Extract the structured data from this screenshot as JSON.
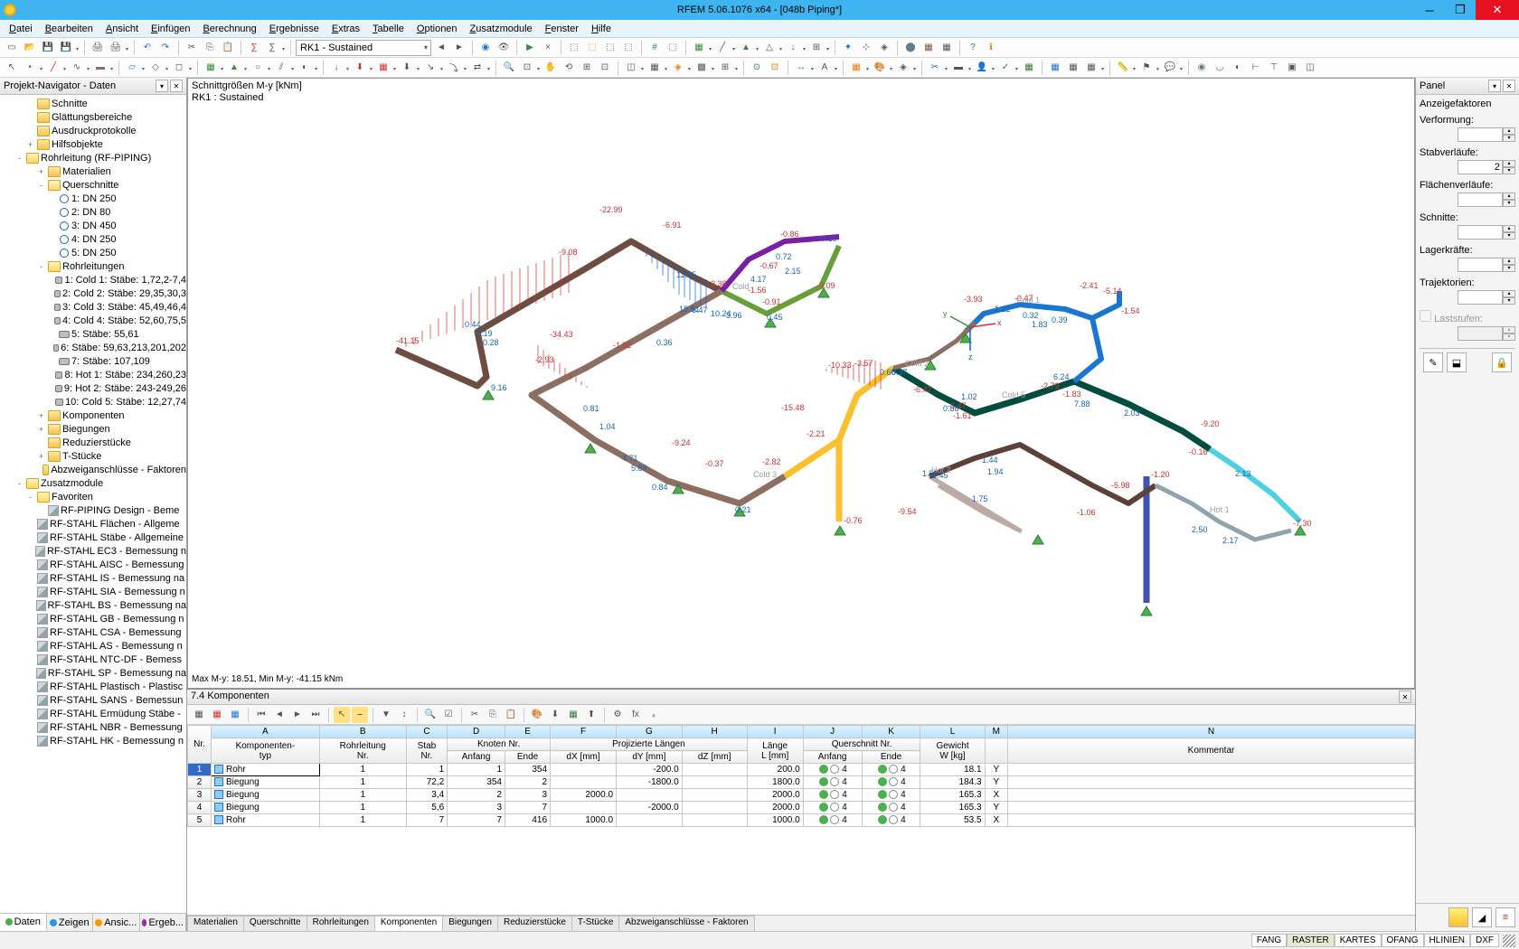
{
  "title": "RFEM 5.06.1076 x64 - [048b Piping*]",
  "menus": [
    "Datei",
    "Bearbeiten",
    "Ansicht",
    "Einfügen",
    "Berechnung",
    "Ergebnisse",
    "Extras",
    "Tabelle",
    "Optionen",
    "Zusatzmodule",
    "Fenster",
    "Hilfe"
  ],
  "combo_rk": "RK1 - Sustained",
  "navigator": {
    "title": "Projekt-Navigator - Daten",
    "tabs": [
      "Daten",
      "Zeigen",
      "Ansic...",
      "Ergeb..."
    ],
    "top_nodes": [
      {
        "label": "Schnitte",
        "type": "fold"
      },
      {
        "label": "Glättungsbereiche",
        "type": "fold"
      },
      {
        "label": "Ausdruckprotokolle",
        "type": "fold"
      },
      {
        "label": "Hilfsobjekte",
        "type": "fold",
        "expander": "+"
      }
    ],
    "piping_root": "Rohrleitung (RF-PIPING)",
    "piping": [
      {
        "label": "Materialien",
        "type": "fold",
        "expander": "+",
        "indent": 3
      },
      {
        "label": "Querschnitte",
        "type": "fold",
        "expander": "-",
        "indent": 3
      },
      {
        "label": "1: DN 250",
        "type": "circ",
        "indent": 4
      },
      {
        "label": "2: DN 80",
        "type": "circ",
        "indent": 4
      },
      {
        "label": "3: DN 450",
        "type": "circ",
        "indent": 4
      },
      {
        "label": "4: DN 250",
        "type": "circ",
        "indent": 4
      },
      {
        "label": "5: DN 250",
        "type": "circ",
        "indent": 4
      },
      {
        "label": "Rohrleitungen",
        "type": "fold",
        "expander": "-",
        "indent": 3
      },
      {
        "label": "1: Cold 1: Stäbe: 1,72,2-7,4",
        "type": "pipe",
        "indent": 4
      },
      {
        "label": "2: Cold 2: Stäbe: 29,35,30,3",
        "type": "pipe",
        "indent": 4
      },
      {
        "label": "3: Cold 3: Stäbe: 45,49,46,4",
        "type": "pipe",
        "indent": 4
      },
      {
        "label": "4: Cold 4: Stäbe: 52,60,75,5",
        "type": "pipe",
        "indent": 4
      },
      {
        "label": "5: Stäbe: 55,61",
        "type": "pipe",
        "indent": 4
      },
      {
        "label": "6: Stäbe: 59,63,213,201,202",
        "type": "pipe",
        "indent": 4
      },
      {
        "label": "7: Stäbe: 107,109",
        "type": "pipe",
        "indent": 4
      },
      {
        "label": "8: Hot 1: Stäbe: 234,260,23",
        "type": "pipe",
        "indent": 4
      },
      {
        "label": "9: Hot 2: Stäbe: 243-249,26",
        "type": "pipe",
        "indent": 4
      },
      {
        "label": "10: Cold 5: Stäbe: 12,27,74",
        "type": "pipe",
        "indent": 4
      },
      {
        "label": "Komponenten",
        "type": "fold",
        "expander": "+",
        "indent": 3
      },
      {
        "label": "Biegungen",
        "type": "fold",
        "expander": "+",
        "indent": 3
      },
      {
        "label": "Reduzierstücke",
        "type": "fold",
        "indent": 3
      },
      {
        "label": "T-Stücke",
        "type": "fold",
        "expander": "+",
        "indent": 3
      },
      {
        "label": "Abzweiganschlüsse - Faktoren",
        "type": "fold",
        "indent": 3
      }
    ],
    "zusatz_root": "Zusatzmodule",
    "favoriten": "Favoriten",
    "fav_item": "RF-PIPING Design - Beme",
    "modules": [
      "RF-STAHL Flächen - Allgeme",
      "RF-STAHL Stäbe - Allgemeine",
      "RF-STAHL EC3 - Bemessung n",
      "RF-STAHL AISC - Bemessung",
      "RF-STAHL IS - Bemessung na",
      "RF-STAHL SIA - Bemessung n",
      "RF-STAHL BS - Bemessung na",
      "RF-STAHL GB - Bemessung n",
      "RF-STAHL CSA - Bemessung",
      "RF-STAHL AS - Bemessung n",
      "RF-STAHL NTC-DF - Bemess",
      "RF-STAHL SP - Bemessung na",
      "RF-STAHL Plastisch - Plastisc",
      "RF-STAHL SANS - Bemessun",
      "RF-STAHL Ermüdung Stäbe -",
      "RF-STAHL NBR - Bemessung",
      "RF-STAHL HK - Bemessung n"
    ]
  },
  "viewport": {
    "line1": "Schnittgrößen M-y [kNm]",
    "line2": "RK1 : Sustained",
    "status": "Max M-y: 18.51, Min M-y: -41.15 kNm",
    "vals_r": [
      [
        "-22.99",
        455,
        148
      ],
      [
        "-6.91",
        525,
        165
      ],
      [
        "-9.08",
        410,
        195
      ],
      [
        "-41.15",
        230,
        293
      ],
      [
        "-34.43",
        400,
        286
      ],
      [
        "-2.38",
        575,
        230
      ],
      [
        "-1.52",
        470,
        298
      ],
      [
        "-0.67",
        632,
        210
      ],
      [
        "-2.93",
        384,
        314
      ],
      [
        "-0.86",
        655,
        175
      ],
      [
        "-1.56",
        619,
        237
      ],
      [
        "-0.09",
        695,
        232
      ],
      [
        "-9.24",
        535,
        406
      ],
      [
        "-0.91",
        635,
        250
      ],
      [
        "-10.33",
        708,
        320
      ],
      [
        "-3.57",
        737,
        318
      ],
      [
        "-15.48",
        656,
        367
      ],
      [
        "-2.21",
        684,
        396
      ],
      [
        "-6.47",
        802,
        347
      ],
      [
        "-3.47",
        840,
        365
      ],
      [
        "-0.37",
        572,
        429
      ],
      [
        "-2.82",
        635,
        427
      ],
      [
        "-0.76",
        725,
        492
      ],
      [
        "-1.61",
        846,
        376
      ],
      [
        "-3.93",
        858,
        247
      ],
      [
        "-2.41",
        986,
        232
      ],
      [
        "-5.14",
        1012,
        238
      ],
      [
        "-1.54",
        1032,
        260
      ],
      [
        "-2.79",
        943,
        343
      ],
      [
        "-1.83",
        967,
        352
      ],
      [
        "-0.47",
        914,
        246
      ],
      [
        "-9.54",
        785,
        482
      ],
      [
        "-5.98",
        1021,
        453
      ],
      [
        "-1.06",
        983,
        483
      ],
      [
        "-1.20",
        1065,
        441
      ],
      [
        "-9.20",
        1120,
        385
      ],
      [
        "-7.30",
        1222,
        495
      ],
      [
        "-0.16",
        1107,
        416
      ]
    ],
    "vals_b": [
      [
        "11.05",
        540,
        220
      ],
      [
        "0.10",
        700,
        180
      ],
      [
        "0.72",
        650,
        200
      ],
      [
        "2.15",
        660,
        216
      ],
      [
        "4.17",
        622,
        225
      ],
      [
        "18.51",
        543,
        258
      ],
      [
        "5.47",
        557,
        259
      ],
      [
        "10.24",
        578,
        263
      ],
      [
        "3.96",
        595,
        265
      ],
      [
        "0.45",
        640,
        267
      ],
      [
        "0.19",
        319,
        285
      ],
      [
        "0.28",
        326,
        295
      ],
      [
        "9.16",
        335,
        345
      ],
      [
        "0.81",
        437,
        368
      ],
      [
        "1.04",
        455,
        388
      ],
      [
        "4.71",
        480,
        423
      ],
      [
        "5.89",
        490,
        434
      ],
      [
        "0.84",
        513,
        455
      ],
      [
        "0.21",
        605,
        480
      ],
      [
        "0.36",
        518,
        295
      ],
      [
        "0.44",
        306,
        275
      ],
      [
        "0.37",
        778,
        328
      ],
      [
        "0.60",
        765,
        328
      ],
      [
        "0.88",
        835,
        368
      ],
      [
        "1.02",
        855,
        355
      ],
      [
        "1.22",
        892,
        258
      ],
      [
        "0.32",
        923,
        265
      ],
      [
        "0.39",
        955,
        270
      ],
      [
        "1.83",
        933,
        275
      ],
      [
        "6.24",
        957,
        333
      ],
      [
        "1.44",
        878,
        425
      ],
      [
        "1.94",
        884,
        438
      ],
      [
        "1.75",
        867,
        468
      ],
      [
        "1.55",
        812,
        440
      ],
      [
        "1.45",
        823,
        442
      ],
      [
        "7.88",
        980,
        363
      ],
      [
        "2.03",
        1035,
        373
      ],
      [
        "2.50",
        1110,
        502
      ],
      [
        "2.13",
        1158,
        440
      ],
      [
        "2.17",
        1144,
        514
      ]
    ],
    "pipelabels": [
      [
        "Cold",
        602,
        233
      ],
      [
        "Cold 2",
        793,
        318
      ],
      [
        "Cold 5",
        900,
        353
      ],
      [
        "Cold 1",
        916,
        248
      ],
      [
        "Cold 3",
        625,
        441
      ],
      [
        "Hot 2",
        822,
        436
      ],
      [
        "Hot 1",
        1130,
        480
      ]
    ]
  },
  "table": {
    "title": "7.4 Komponenten",
    "top_cols": [
      "A",
      "B",
      "C",
      "D",
      "E",
      "F",
      "G",
      "H",
      "I",
      "J",
      "K",
      "L",
      "M",
      "N"
    ],
    "group1": "Komponenten-\ntyp",
    "rohr": "Rohrleitung\nNr.",
    "stab": "Stab\nNr.",
    "knoten": "Knoten Nr.",
    "anfang": "Anfang",
    "ende": "Ende",
    "proj": "Projizierte Längen",
    "dX": "dX [mm]",
    "dY": "dY [mm]",
    "dZ": "dZ [mm]",
    "laenge": "Länge\nL [mm]",
    "quers": "Querschnitt Nr.",
    "gew": "Gewicht\nW [kg]",
    "kom": "Kommentar",
    "nr": "Nr.",
    "rows": [
      {
        "n": 1,
        "typ": "Rohr",
        "r": 1,
        "s": "1",
        "a": "1",
        "e": "354",
        "dx": "",
        "dy": "-200.0",
        "dz": "",
        "L": "200.0",
        "qa": "4",
        "qe": "4",
        "W": "18.1",
        "M": "Y",
        "sel": true
      },
      {
        "n": 2,
        "typ": "Biegung",
        "r": 1,
        "s": "72,2",
        "a": "354",
        "e": "2",
        "dx": "",
        "dy": "-1800.0",
        "dz": "",
        "L": "1800.0",
        "qa": "4",
        "qe": "4",
        "W": "184.3",
        "M": "Y"
      },
      {
        "n": 3,
        "typ": "Biegung",
        "r": 1,
        "s": "3,4",
        "a": "2",
        "e": "3",
        "dx": "2000.0",
        "dy": "",
        "dz": "",
        "L": "2000.0",
        "qa": "4",
        "qe": "4",
        "W": "165.3",
        "M": "X"
      },
      {
        "n": 4,
        "typ": "Biegung",
        "r": 1,
        "s": "5,6",
        "a": "3",
        "e": "7",
        "dx": "",
        "dy": "-2000.0",
        "dz": "",
        "L": "2000.0",
        "qa": "4",
        "qe": "4",
        "W": "165.3",
        "M": "Y"
      },
      {
        "n": 5,
        "typ": "Rohr",
        "r": 1,
        "s": "7",
        "a": "7",
        "e": "416",
        "dx": "1000.0",
        "dy": "",
        "dz": "",
        "L": "1000.0",
        "qa": "4",
        "qe": "4",
        "W": "53.5",
        "M": "X"
      }
    ],
    "tabs": [
      "Materialien",
      "Querschnitte",
      "Rohrleitungen",
      "Komponenten",
      "Biegungen",
      "Reduzierstücke",
      "T-Stücke",
      "Abzweiganschlüsse - Faktoren"
    ],
    "active_tab": 3
  },
  "panel": {
    "title": "Panel",
    "header": "Anzeigefaktoren",
    "groups": [
      {
        "label": "Verformung:",
        "val": ""
      },
      {
        "label": "Stabverläufe:",
        "val": "2"
      },
      {
        "label": "Flächenverläufe:",
        "val": ""
      },
      {
        "label": "Schnitte:",
        "val": ""
      },
      {
        "label": "Lagerkräfte:",
        "val": ""
      },
      {
        "label": "Trajektorien:",
        "val": ""
      }
    ],
    "disabled": "Laststufen:"
  },
  "status": [
    "FANG",
    "RASTER",
    "KARTES",
    "OFANG",
    "HLINIEN",
    "DXF"
  ],
  "status_active": 1
}
